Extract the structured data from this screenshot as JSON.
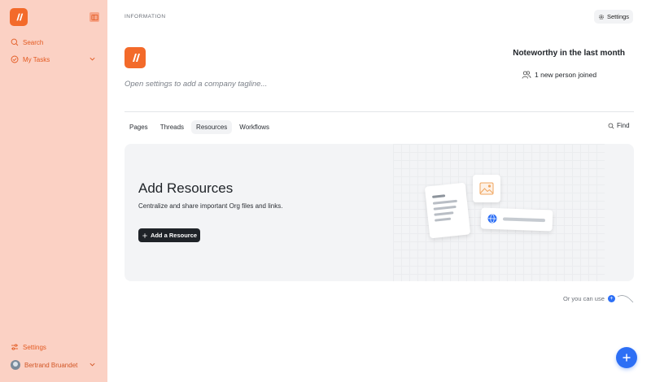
{
  "sidebar": {
    "search_label": "Search",
    "tasks_label": "My Tasks",
    "settings_label": "Settings",
    "user_name": "Bertrand Bruandet"
  },
  "header": {
    "section_label": "INFORMATION",
    "settings_label": "Settings"
  },
  "company": {
    "tagline_placeholder": "Open settings to add a company tagline..."
  },
  "noteworthy": {
    "title": "Noteworthy in the last month",
    "joined_text": "1 new person joined"
  },
  "tabs": [
    {
      "label": "Pages",
      "active": false
    },
    {
      "label": "Threads",
      "active": false
    },
    {
      "label": "Resources",
      "active": true
    },
    {
      "label": "Workflows",
      "active": false
    }
  ],
  "find_label": "Find",
  "resources": {
    "title": "Add Resources",
    "description": "Centralize and share important Org files and links.",
    "add_button_label": "Add a Resource"
  },
  "or_use_label": "Or you can use",
  "colors": {
    "brand": "#f36a2a",
    "sidebar_bg": "#fbd1c4",
    "accent_blue": "#2d6ff5"
  }
}
